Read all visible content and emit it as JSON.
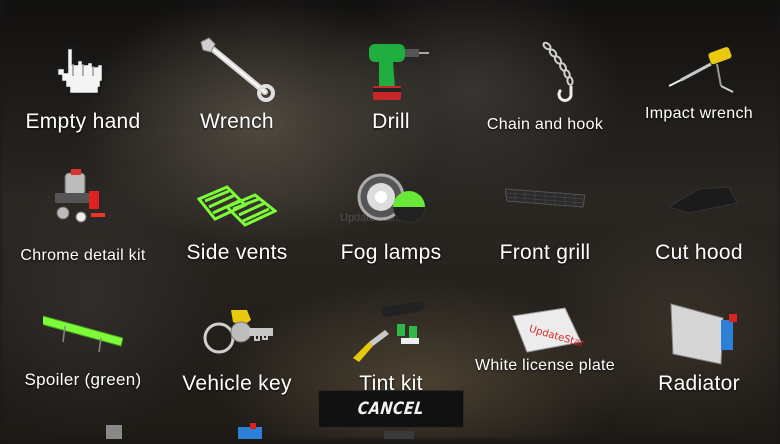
{
  "items": [
    {
      "label": "Empty hand",
      "icon": "hand-pointer-icon"
    },
    {
      "label": "Wrench",
      "icon": "wrench-icon"
    },
    {
      "label": "Drill",
      "icon": "drill-icon"
    },
    {
      "label": "Chain and hook",
      "icon": "chain-hook-icon"
    },
    {
      "label": "Impact wrench",
      "icon": "impact-wrench-icon"
    },
    {
      "label": "Chrome detail kit",
      "icon": "chrome-detail-kit-icon"
    },
    {
      "label": "Side vents",
      "icon": "side-vents-icon"
    },
    {
      "label": "Fog lamps",
      "icon": "fog-lamps-icon"
    },
    {
      "label": "Front grill",
      "icon": "front-grill-icon"
    },
    {
      "label": "Cut hood",
      "icon": "cut-hood-icon"
    },
    {
      "label": "Spoiler (green)",
      "icon": "spoiler-icon"
    },
    {
      "label": "Vehicle key",
      "icon": "vehicle-key-icon"
    },
    {
      "label": "Tint kit",
      "icon": "tint-kit-icon"
    },
    {
      "label": "White license plate",
      "icon": "license-plate-icon"
    },
    {
      "label": "Radiator",
      "icon": "radiator-icon"
    }
  ],
  "cancel_label": "CANCEL",
  "watermark": "UpdateStar.com",
  "colors": {
    "accent_green": "#7dfc3a",
    "drill_green": "#1fae3f",
    "text": "#ffffff"
  }
}
